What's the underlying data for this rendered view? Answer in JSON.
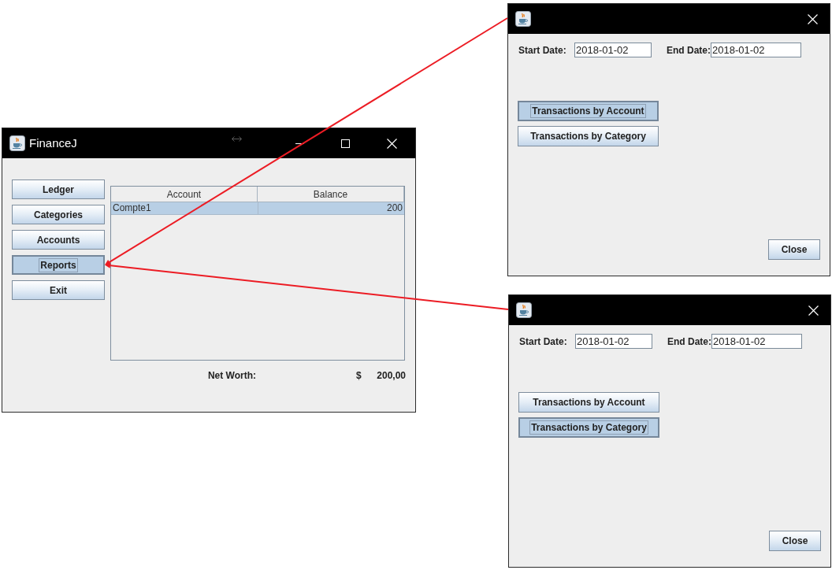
{
  "main_window": {
    "title": "FinanceJ",
    "nav_buttons": [
      {
        "label": "Ledger",
        "selected": false
      },
      {
        "label": "Categories",
        "selected": false
      },
      {
        "label": "Accounts",
        "selected": false
      },
      {
        "label": "Reports",
        "selected": true
      },
      {
        "label": "Exit",
        "selected": false
      }
    ],
    "accounts_table": {
      "columns": [
        "Account",
        "Balance"
      ],
      "rows": [
        {
          "cells": [
            "Compte1",
            "200"
          ],
          "selected": true
        }
      ]
    },
    "net_worth": {
      "label": "Net Worth:",
      "currency": "$",
      "amount": "200,00"
    }
  },
  "report_windows": [
    {
      "start_date": {
        "label": "Start Date:",
        "value": "2018-01-02"
      },
      "end_date": {
        "label": "End Date:",
        "value": "2018-01-02"
      },
      "report_buttons": [
        {
          "label": "Transactions by Account",
          "selected": true
        },
        {
          "label": "Transactions by Category",
          "selected": false
        }
      ],
      "close_button": {
        "label": "Close"
      }
    },
    {
      "start_date": {
        "label": "Start Date:",
        "value": "2018-01-02"
      },
      "end_date": {
        "label": "End Date:",
        "value": "2018-01-02"
      },
      "report_buttons": [
        {
          "label": "Transactions by Account",
          "selected": false
        },
        {
          "label": "Transactions by Category",
          "selected": true
        }
      ],
      "close_button": {
        "label": "Close"
      }
    }
  ]
}
